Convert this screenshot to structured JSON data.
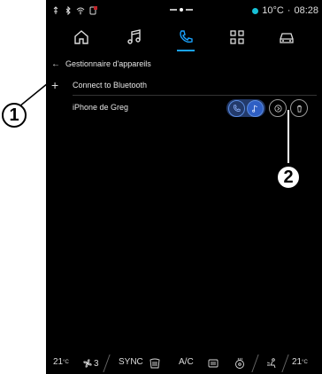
{
  "status_bar": {
    "left_icons": [
      "usb-icon",
      "bluetooth-icon",
      "wifi-icon",
      "phone-alert-icon"
    ],
    "temperature": "10°C",
    "separator": "·",
    "time": "08:28"
  },
  "nav": {
    "items": [
      {
        "name": "home-icon",
        "active": false
      },
      {
        "name": "music-icon",
        "active": false
      },
      {
        "name": "phone-icon",
        "active": true
      },
      {
        "name": "apps-icon",
        "active": false
      },
      {
        "name": "car-icon",
        "active": false
      }
    ]
  },
  "breadcrumb": {
    "back": "←",
    "title": "Gestionnaire d'appareils"
  },
  "list": {
    "add_label": "Connect to Bluetooth",
    "add_symbol": "+",
    "device_name": "iPhone de Greg"
  },
  "climate": {
    "left_temp": "21",
    "left_unit": "°C",
    "fan_level": "3",
    "sync": "SYNC",
    "ac": "A/C",
    "right_temp": "21",
    "right_unit": "°C"
  },
  "callouts": {
    "one": "1",
    "two": "2"
  },
  "colors": {
    "accent": "#1aa3ff",
    "temp_dot": "#17c0d6",
    "device_pill": "#233a6a"
  }
}
